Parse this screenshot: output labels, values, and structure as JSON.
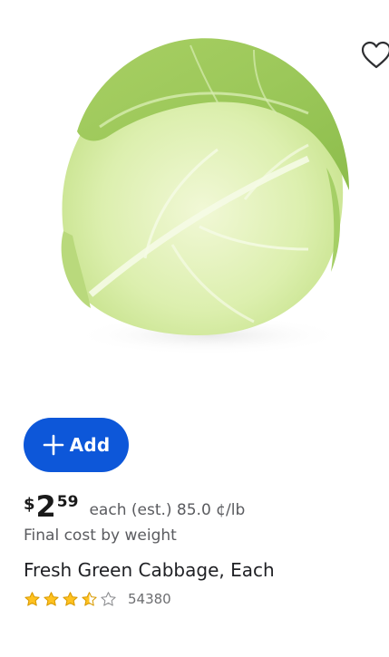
{
  "product": {
    "image_alt": "Fresh Green Cabbage",
    "title": "Fresh Green Cabbage, Each",
    "price": {
      "currency_symbol": "$",
      "dollars": "2",
      "cents": "59"
    },
    "unit_info": "each (est.) 85.0 ¢/lb",
    "final_cost_note": "Final cost by weight",
    "rating": {
      "value": 3.5,
      "max": 5,
      "review_count": "54380"
    }
  },
  "actions": {
    "add_label": "Add",
    "favorite_icon": "heart-outline-icon"
  },
  "colors": {
    "add_button": "#0d57d9",
    "star_fill": "#ffc220",
    "star_outline": "#8a8b8e"
  }
}
